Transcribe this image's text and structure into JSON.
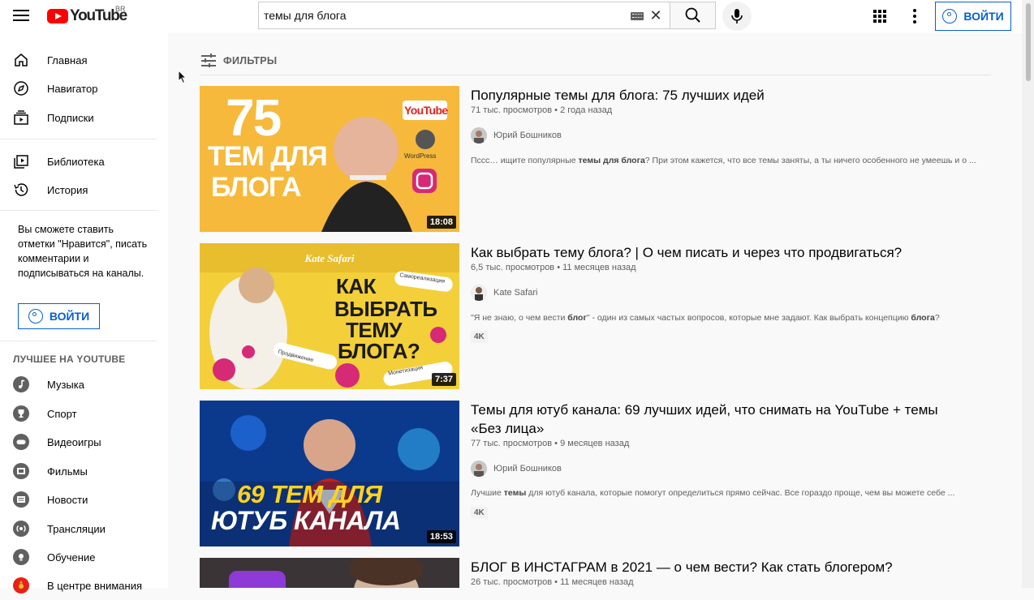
{
  "header": {
    "logo_text": "YouTube",
    "country_code": "BR",
    "search_value": "темы для блога",
    "signin_label": "ВОЙТИ"
  },
  "sidebar": {
    "main_items": [
      {
        "label": "Главная",
        "icon": "home-icon"
      },
      {
        "label": "Навигатор",
        "icon": "compass-icon"
      },
      {
        "label": "Подписки",
        "icon": "subscriptions-icon"
      }
    ],
    "library_items": [
      {
        "label": "Библиотека",
        "icon": "library-icon"
      },
      {
        "label": "История",
        "icon": "history-icon"
      }
    ],
    "signin_prompt": "Вы сможете ставить отметки \"Нравится\", писать комментарии и подписываться на каналы.",
    "signin_label": "ВОЙТИ",
    "best_title": "ЛУЧШЕЕ НА YOUTUBE",
    "best_items": [
      {
        "label": "Музыка",
        "icon": "music-icon"
      },
      {
        "label": "Спорт",
        "icon": "trophy-icon"
      },
      {
        "label": "Видеоигры",
        "icon": "gaming-icon"
      },
      {
        "label": "Фильмы",
        "icon": "movies-icon"
      },
      {
        "label": "Новости",
        "icon": "news-icon"
      },
      {
        "label": "Трансляции",
        "icon": "live-icon"
      },
      {
        "label": "Обучение",
        "icon": "learning-icon"
      },
      {
        "label": "В центре внимания",
        "icon": "spotlight-icon"
      }
    ]
  },
  "filters": {
    "label": "ФИЛЬТРЫ"
  },
  "videos": [
    {
      "title": "Популярные темы для блога: 75 лучших идей",
      "views": "71 тыс. просмотров",
      "age": "2 года назад",
      "channel": "Юрий Бошников",
      "desc_before": "Пссс… ищите популярные ",
      "desc_bold": "темы для блога",
      "desc_after": "? При этом кажется, что все темы заняты, а ты ничего особенного не умеешь и о ...",
      "duration": "18:08",
      "thumb_text_1": "75",
      "thumb_text_2": "ТЕМ ДЛЯ",
      "thumb_text_3": "БЛОГА",
      "thumb_logo": "YouTube",
      "thumb_wp": "WordPress"
    },
    {
      "title": "Как выбрать тему блога? | О чем писать и через что продвигаться?",
      "views": "6,5 тыс. просмотров",
      "age": "11 месяцев назад",
      "channel": "Kate Safari",
      "desc_before": "\"Я не знаю, о чем вести ",
      "desc_bold": "блог",
      "desc_after": "\" - один из самых частых вопросов, которые мне задают. Как выбрать концепцию ",
      "desc_bold2": "блога",
      "desc_after2": "?",
      "badge": "4K",
      "duration": "7:37",
      "thumb_text_1": "КАК",
      "thumb_text_2": "ВЫБРАТЬ",
      "thumb_text_3": "ТЕМУ",
      "thumb_text_4": "БЛОГА?",
      "thumb_banner": "Kate Safari",
      "thumb_tag_1": "Самореализация",
      "thumb_tag_2": "Продвижение",
      "thumb_tag_3": "Монетизация"
    },
    {
      "title": "Темы для ютуб канала: 69 лучших идей, что снимать на YouTube + темы «Без лица»",
      "views": "77 тыс. просмотров",
      "age": "9 месяцев назад",
      "channel": "Юрий Бошников",
      "desc_before": "Лучшие ",
      "desc_bold": "темы",
      "desc_after": " для ютуб канала, которые помогут определиться прямо сейчас. Все гораздо проще, чем вы можете себе ...",
      "badge": "4K",
      "duration": "18:53",
      "thumb_text_1": "69 ТЕМ ДЛЯ",
      "thumb_text_2": "ЮТУБ КАНАЛА"
    },
    {
      "title": "БЛОГ В ИНСТАГРАМ в 2021 — о чем вести? Как стать блогером?",
      "views": "26 тыс. просмотров",
      "age": "11 месяцев назад"
    }
  ]
}
